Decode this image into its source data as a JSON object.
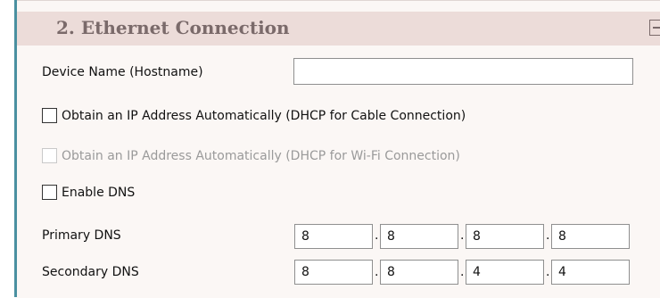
{
  "section": {
    "title": "2. Ethernet Connection"
  },
  "hostname": {
    "label": "Device Name (Hostname)",
    "value": ""
  },
  "dhcp_cable": {
    "label": "Obtain an IP Address Automatically (DHCP for Cable Connection)",
    "checked": false
  },
  "dhcp_wifi": {
    "label": "Obtain an IP Address Automatically (DHCP for Wi-Fi Connection)",
    "checked": false,
    "disabled": true
  },
  "enable_dns": {
    "label": "Enable DNS",
    "checked": false
  },
  "primary_dns": {
    "label": "Primary DNS",
    "octets": [
      "8",
      "8",
      "8",
      "8"
    ]
  },
  "secondary_dns": {
    "label": "Secondary DNS",
    "octets": [
      "8",
      "8",
      "4",
      "4"
    ]
  },
  "separator": ".",
  "icons": {
    "collapse": "minus-box-icon"
  },
  "colors": {
    "header_bg": "#ecdcd9",
    "panel_bg": "#fbf7f5",
    "accent_bar": "#4a90a0",
    "title_text": "#7a6a6a"
  }
}
